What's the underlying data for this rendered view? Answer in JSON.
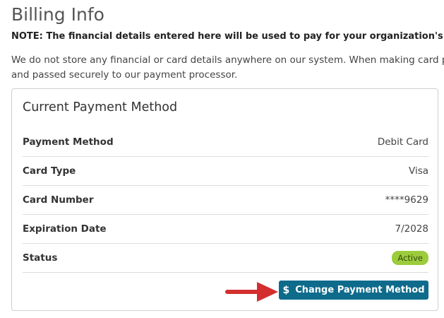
{
  "page": {
    "title": "Billing Info",
    "note": "NOTE: The financial details entered here will be used to pay for your organization's subs",
    "description_line1": "We do not store any financial or card details anywhere on our system. When making card paym",
    "description_line2": "and passed securely to our payment processor."
  },
  "card": {
    "title": "Current Payment Method",
    "rows": [
      {
        "label": "Payment Method",
        "value": "Debit Card"
      },
      {
        "label": "Card Type",
        "value": "Visa"
      },
      {
        "label": "Card Number",
        "value": "****9629"
      },
      {
        "label": "Expiration Date",
        "value": "7/2028"
      },
      {
        "label": "Status",
        "value": "Active"
      }
    ],
    "button": {
      "icon": "$",
      "label": "Change Payment Method"
    }
  },
  "colors": {
    "button_bg": "#0e6b8c",
    "status_badge_bg": "#9ccc3c",
    "annotation_arrow": "#d32f2f"
  }
}
